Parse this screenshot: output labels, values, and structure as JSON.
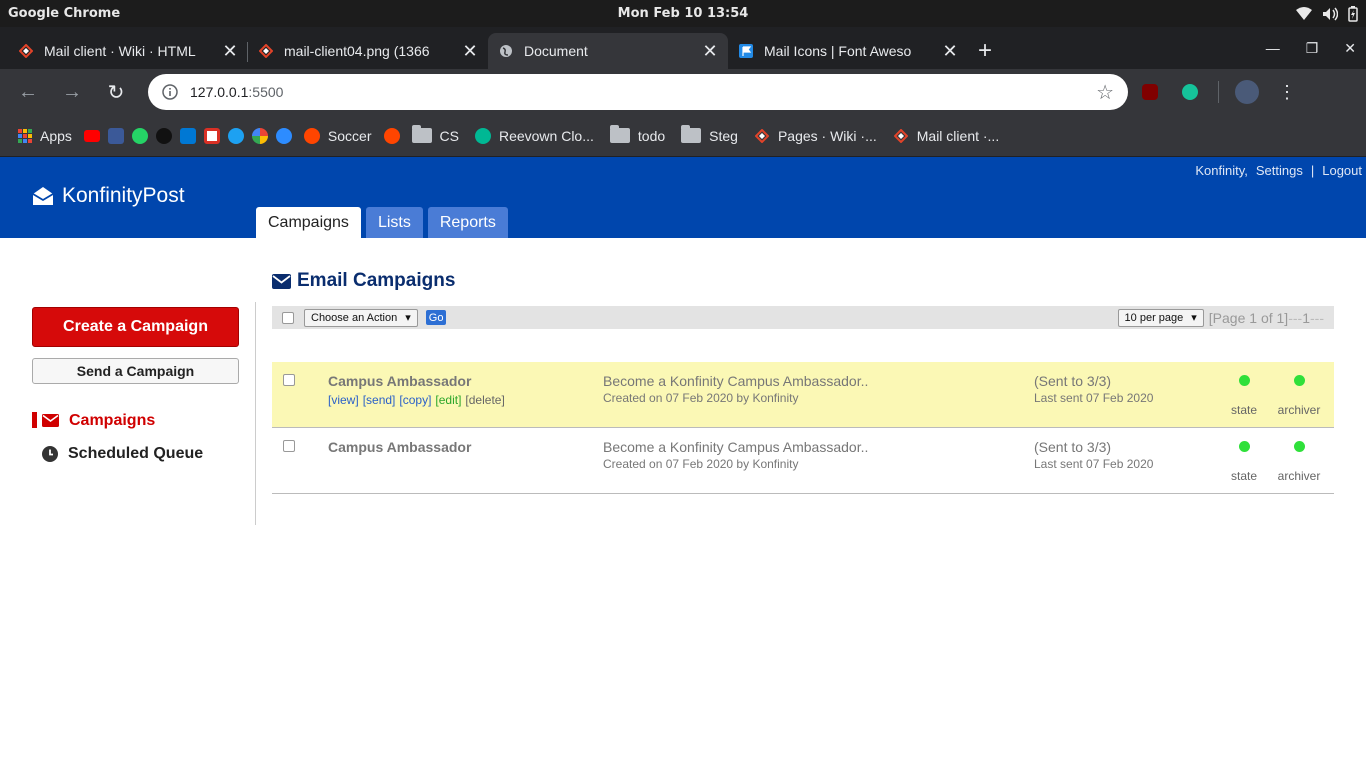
{
  "os": {
    "app_name": "Google Chrome",
    "clock": "Mon Feb 10  13:54"
  },
  "browser": {
    "tabs": [
      {
        "title": "Mail client · Wiki · HTML",
        "favicon": "gitlab-diamond-icon"
      },
      {
        "title": "mail-client04.png (1366",
        "favicon": "gitlab-diamond-icon"
      },
      {
        "title": "Document",
        "favicon": "globe-icon"
      },
      {
        "title": "Mail Icons | Font Aweso",
        "favicon": "font-awesome-flag-icon"
      }
    ],
    "address": {
      "host": "127.0.0.1",
      "port": ":5500"
    },
    "bookmarks": [
      {
        "label": "Apps"
      },
      {
        "label": "Soccer"
      },
      {
        "label": "CS"
      },
      {
        "label": "Reevown Clo..."
      },
      {
        "label": "todo"
      },
      {
        "label": "Steg"
      },
      {
        "label": "Pages · Wiki ·..."
      },
      {
        "label": "Mail client ·..."
      }
    ]
  },
  "app": {
    "brand": "KonfinityPost",
    "top_links": {
      "user": "Konfinity,",
      "settings": "Settings",
      "sep": "|",
      "logout": "Logout"
    },
    "tabs": [
      "Campaigns",
      "Lists",
      "Reports"
    ],
    "active_tab": "Campaigns",
    "accent": "#0046ad"
  },
  "sidebar": {
    "create": "Create a Campaign",
    "send": "Send a Campaign",
    "nav": [
      {
        "label": "Campaigns",
        "icon": "envelope-icon"
      },
      {
        "label": "Scheduled Queue",
        "icon": "clock-icon"
      }
    ]
  },
  "main": {
    "heading": "Email Campaigns",
    "action_select": "Choose an Action",
    "go": "Go",
    "per_page": "10 per page",
    "page_info": "[Page 1 of 1]",
    "page_dashes_a": "---",
    "page_num": "1",
    "page_dashes_b": "---",
    "links": {
      "view": "[view]",
      "send": "[send]",
      "copy": "[copy]",
      "edit": "[edit]",
      "delete": "[delete]"
    },
    "campaigns": [
      {
        "name": "Campus Ambassador",
        "subject": "Become a Konfinity Campus Ambassador..",
        "created": "Created on 07 Feb 2020 by Konfinity",
        "sent": "(Sent to 3/3)",
        "last_sent": "Last sent 07 Feb 2020",
        "state_label": "state",
        "archiver_label": "archiver"
      },
      {
        "name": "Campus Ambassador",
        "subject": "Become a Konfinity Campus Ambassador..",
        "created": "Created on 07 Feb 2020 by Konfinity",
        "sent": "(Sent to 3/3)",
        "last_sent": "Last sent 07 Feb 2020",
        "state_label": "state",
        "archiver_label": "archiver"
      }
    ]
  }
}
